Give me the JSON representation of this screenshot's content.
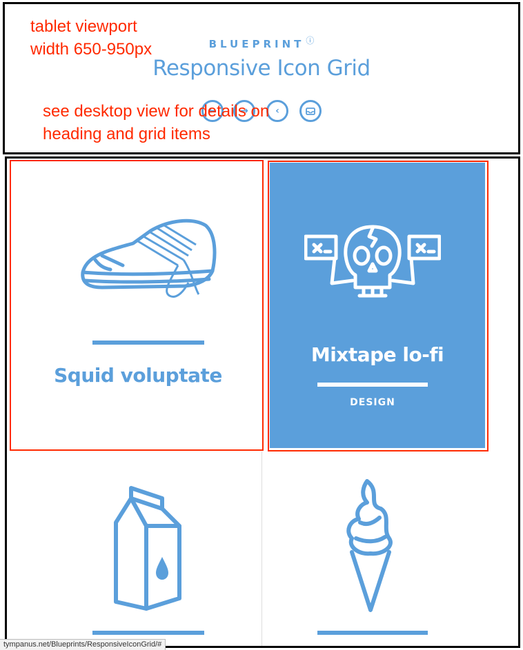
{
  "annotations": {
    "viewport_note": "tablet viewport\nwidth 650-950px",
    "details_note": "see desktop view for details on\nheading and grid items"
  },
  "header": {
    "brand": "BLUEPRINT",
    "brand_mark": "?",
    "title": "Responsive Icon Grid",
    "nav_buttons": [
      {
        "name": "previous-icon",
        "glyph": "←"
      },
      {
        "name": "next-icon",
        "glyph": "→"
      },
      {
        "name": "back-icon",
        "glyph": "‹"
      },
      {
        "name": "archive-icon",
        "glyph": ""
      }
    ]
  },
  "grid": {
    "items": [
      {
        "title": "Squid voluptate",
        "tag": "",
        "icon": "sneaker-icon",
        "active": false
      },
      {
        "title": "Mixtape lo-fi",
        "tag": "DESIGN",
        "icon": "skull-banner-icon",
        "active": true
      },
      {
        "title": "",
        "tag": "",
        "icon": "milk-carton-icon",
        "active": false
      },
      {
        "title": "",
        "tag": "",
        "icon": "ice-cream-cone-icon",
        "active": false
      }
    ]
  },
  "status_bar": {
    "url": "tympanus.net/Blueprints/ResponsiveIconGrid/#"
  },
  "colors": {
    "accent": "#5b9fdb",
    "annotation": "#ff2a00",
    "background": "#ffffff"
  }
}
